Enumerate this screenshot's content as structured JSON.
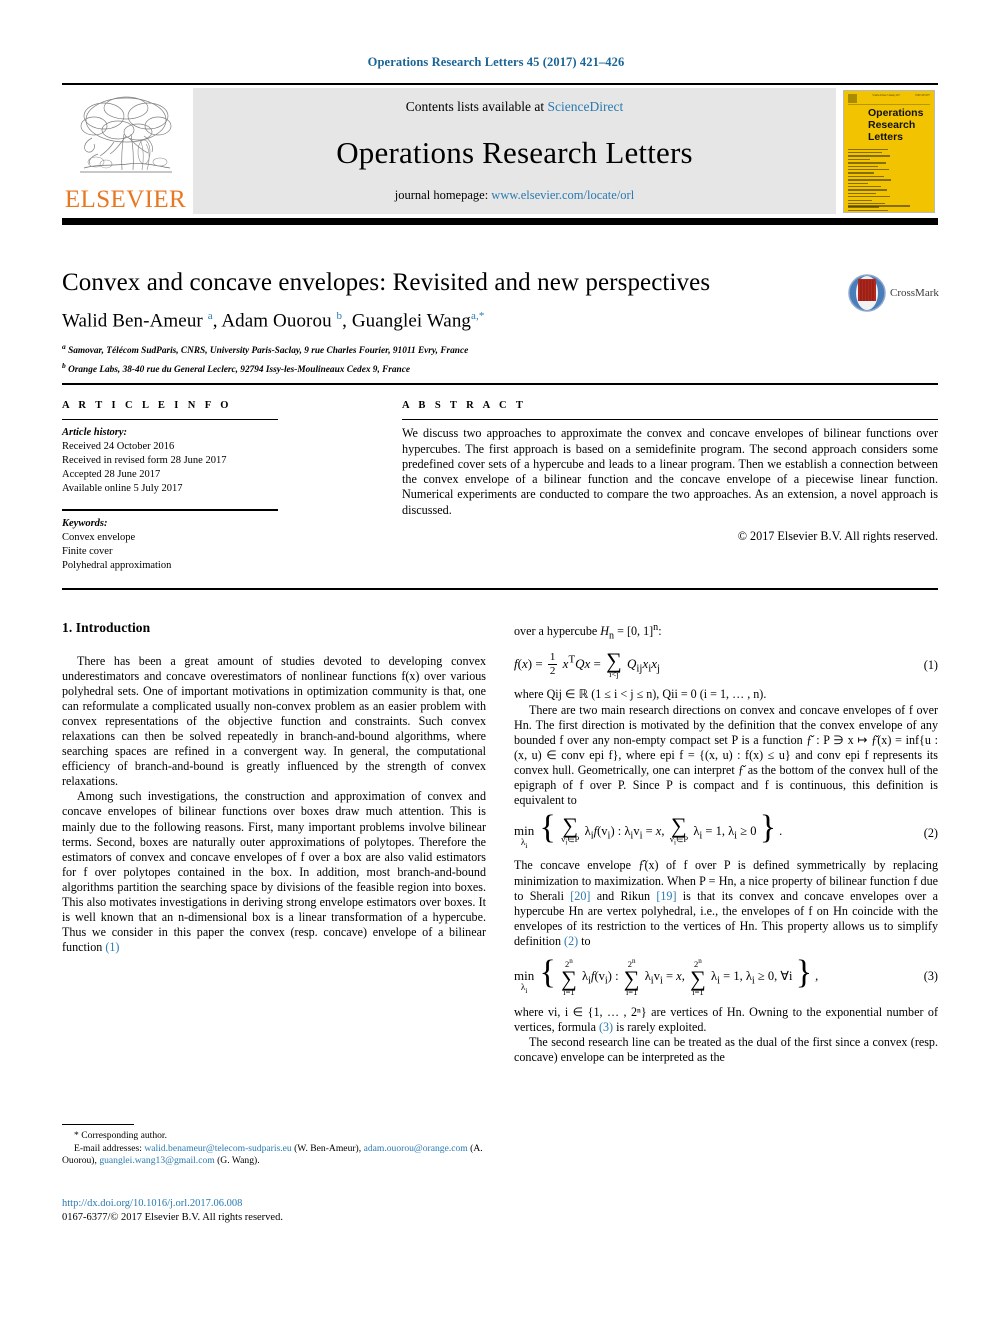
{
  "running_head": "Operations Research Letters 45 (2017) 421–426",
  "masthead": {
    "contents_prefix": "Contents lists available at ",
    "contents_link": "ScienceDirect",
    "journal_title": "Operations Research Letters",
    "homepage_prefix": "journal homepage: ",
    "homepage_link": "www.elsevier.com/locate/orl",
    "publisher_wordmark": "ELSEVIER",
    "cover_title": "Operations Research Letters",
    "link_color": "#2a7ab0",
    "cover_color": "#F2C300",
    "wordmark_color": "#E87722"
  },
  "title_block": {
    "title": "Convex and concave envelopes: Revisited and new perspectives",
    "authors_html": "Walid Ben-Ameur <sup>a</sup>, Adam Ouorou <sup>b</sup>, Guanglei Wang<sup>a,*</sup>",
    "authors_plain": "Walid Ben-Ameur a, Adam Ouorou b, Guanglei Wang a,*",
    "affiliation_a": "Samovar, Télécom SudParis, CNRS, University Paris-Saclay, 9 rue Charles Fourier, 91011 Evry, France",
    "affiliation_b": "Orange Labs, 38-40 rue du General Leclerc, 92794 Issy-les-Moulineaux Cedex 9, France",
    "crossmark_label": "CrossMark"
  },
  "article_info": {
    "heading": "A R T I C L E   I N F O",
    "history_label": "Article history:",
    "history": [
      "Received 24 October 2016",
      "Received in revised form 28 June 2017",
      "Accepted 28 June 2017",
      "Available online 5 July 2017"
    ],
    "keywords_label": "Keywords:",
    "keywords": [
      "Convex envelope",
      "Finite cover",
      "Polyhedral approximation"
    ]
  },
  "abstract": {
    "heading": "A B S T R A C T",
    "text": "We discuss two approaches to approximate the convex and concave envelopes of bilinear functions over hypercubes. The first approach is based on a semidefinite program. The second approach considers some predefined cover sets of a hypercube and leads to a linear program. Then we establish a connection between the convex envelope of a bilinear function and the concave envelope of a piecewise linear function. Numerical experiments are conducted to compare the two approaches. As an extension, a novel approach is discussed.",
    "copyright": "© 2017 Elsevier B.V. All rights reserved."
  },
  "body": {
    "section1_heading": "1.  Introduction",
    "left_p1": "There has been a great amount of studies devoted to developing convex underestimators and concave overestimators of nonlinear functions f(x) over various polyhedral sets. One of important motivations in optimization community is that, one can reformulate a complicated usually non-convex problem as an easier problem with convex representations of the objective function and constraints. Such convex relaxations can then be solved repeatedly in branch-and-bound algorithms, where searching spaces are refined in a convergent way. In general, the computational efficiency of branch-and-bound is greatly influenced by the strength of convex relaxations.",
    "left_p2_a": "Among such investigations, the construction and approximation of convex and concave envelopes of bilinear functions over boxes draw much attention. This is mainly due to the following reasons. First, many important problems involve bilinear terms. Second, boxes are naturally outer approximations of polytopes. Therefore the estimators of convex and concave envelopes of f over a box are also valid estimators for f over polytopes contained in the box. In addition, most branch-and-bound algorithms partition the searching space by divisions of the feasible region into boxes. This also motivates investigations in deriving strong envelope estimators over boxes. It is well known that an n-dimensional box is a linear transformation of a hypercube. Thus we consider in this paper the convex (resp. concave) envelope of a bilinear function ",
    "left_p2_ref": "(1)",
    "right_lead": "over a hypercube H",
    "right_lead_sub": "n",
    "right_lead_rest": " = [0, 1]",
    "right_lead_sup": "n",
    "right_lead_colon": ":",
    "eq1": {
      "lhs": "f(x) =",
      "frac_num": "1",
      "frac_den": "2",
      "mid": "x",
      "mid_sup": "T",
      "mid2": "Qx =",
      "sum_sub": "i<j",
      "sum_body": "Q",
      "sum_body_sub": "ij",
      "sum_body2": "x",
      "sum_body2_sub": "i",
      "sum_body3": "x",
      "sum_body3_sub": "j",
      "number": "(1)"
    },
    "right_p1": "where Qij ∈ ℝ (1 ≤ i < j ≤ n), Qii = 0 (i = 1, … , n).",
    "right_p2": "There are two main research directions on convex and concave envelopes of f over Hn. The first direction is motivated by the definition that the convex envelope of any bounded f over any non-empty compact set P is a function ƒ̌ : P ∋ x ↦ ƒ̌(x) = inf{u : (x, u) ∈ conv epi f}, where epi f = {(x, u) : f(x) ≤ u} and conv epi f represents its convex hull. Geometrically, one can interpret ƒ̌ as the bottom of the convex hull of the epigraph of f over P. Since P is compact and f is continuous, this definition is equivalent to",
    "eq2": {
      "min": "min",
      "min_sub": "λi",
      "open": "{",
      "sum1_sub": "vi∈P",
      "body1": "λif(vi) : λivi = x,",
      "sum2_sub": "vi∈P",
      "body2": "λi = 1, λi ≥ 0",
      "close": "}",
      "tail": ".",
      "number": "(2)"
    },
    "right_p3_a": "The concave envelope ƒ̂(x) of f over P is defined symmetrically by replacing minimization to maximization. When P = Hn, a nice property of bilinear function f due to Sherali ",
    "ref20": "[20]",
    "right_p3_b": " and Rikun ",
    "ref19": "[19]",
    "right_p3_c": " is that its convex and concave envelopes over a hypercube Hn are vertex polyhedral, i.e., the envelopes of f on Hn coincide with the envelopes of its restriction to the vertices of Hn. This property allows us to simplify definition ",
    "ref2": "(2)",
    "right_p3_d": " to",
    "eq3": {
      "min": "min",
      "min_sub": "λi",
      "sum_sup": "2ⁿ",
      "sum_sub": "i=1",
      "body1": "λif(vi) :",
      "body2": "λivi = x,",
      "body3": "λi = 1, λi ≥ 0, ∀i",
      "tail": ",",
      "number": "(3)"
    },
    "right_p4_a": "where vi, i ∈ {1, … , 2ⁿ} are vertices of Hn. Owning to the exponential number of vertices, formula ",
    "ref3": "(3)",
    "right_p4_b": " is rarely exploited.",
    "right_p5": "The second research line can be treated as the dual of the first since a convex (resp. concave) envelope can be interpreted as the"
  },
  "footnote": {
    "corresponding": "* Corresponding author.",
    "email_label": "E-mail addresses:",
    "email1": "walid.benameur@telecom-sudparis.eu",
    "email1_who": " (W. Ben-Ameur),",
    "email2": "adam.ouorou@orange.com",
    "email2_who": " (A. Ouorou),",
    "email3": "guanglei.wang13@gmail.com",
    "email3_who": " (G. Wang)."
  },
  "doi_block": {
    "doi": "http://dx.doi.org/10.1016/j.orl.2017.06.008",
    "issn": "0167-6377/© 2017 Elsevier B.V. All rights reserved."
  }
}
